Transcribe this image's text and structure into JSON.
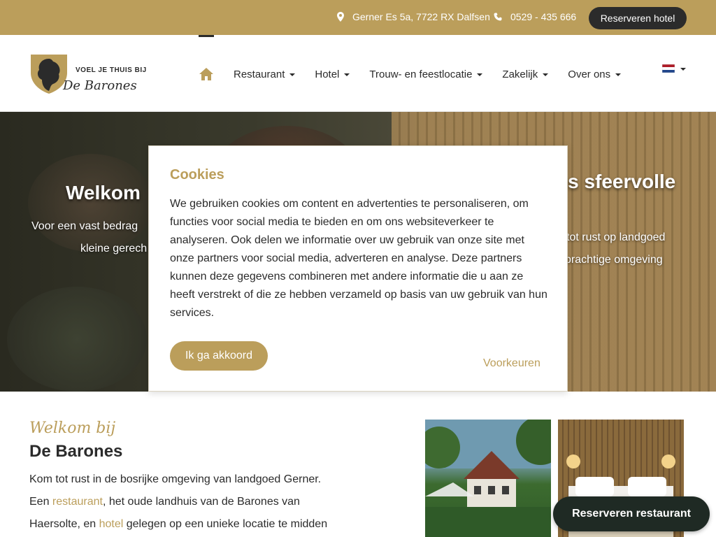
{
  "topbar": {
    "address": "Gerner Es 5a, 7722 RX Dalfsen",
    "phone": "0529 - 435 666",
    "reserve_hotel_label": "Reserveren hotel",
    "address_icon": "map-marker-icon",
    "phone_icon": "phone-icon"
  },
  "logo": {
    "tagline": "VOEL JE THUIS BIJ",
    "brand": "De Barones"
  },
  "nav": {
    "home_icon": "home-icon",
    "items": [
      {
        "label": "Restaurant"
      },
      {
        "label": "Hotel"
      },
      {
        "label": "Trouw- en feestlocatie"
      },
      {
        "label": "Zakelijk"
      },
      {
        "label": "Over ons"
      }
    ],
    "language_flag": "dutch-flag-icon"
  },
  "hero": {
    "title_left": "Welkom",
    "text_left_line1": "Voor een vast bedrag",
    "text_left_line2": "kleine gerech",
    "title_right": "ns sfeervolle",
    "text_right_line1": "tot rust op landgoed",
    "text_right_line2": "prachtige omgeving"
  },
  "cookie": {
    "title": "Cookies",
    "body": "We gebruiken cookies om content en advertenties te personaliseren, om functies voor social media te bieden en om ons websiteverkeer te analyseren. Ook delen we informatie over uw gebruik van onze site met onze partners voor social media, adverteren en analyse. Deze partners kunnen deze gegevens combineren met andere informatie die u aan ze heeft verstrekt of die ze hebben verzameld op basis van uw gebruik van hun services.",
    "accept_label": "Ik ga akkoord",
    "prefs_label": "Voorkeuren"
  },
  "welcome": {
    "script": "Welkom bij",
    "title": "De Barones",
    "line1": "Kom tot rust in de bosrijke omgeving van landgoed Gerner.",
    "line2_pre": "Een ",
    "line2_link": "restaurant",
    "line2_post": ", het oude landhuis van de Barones van",
    "line3_pre": "Haersolte, en ",
    "line3_link": "hotel",
    "line3_post": " gelegen op een unieke locatie te midden"
  },
  "floating": {
    "reserve_restaurant_label": "Reserveren restaurant"
  },
  "colors": {
    "accent": "#bb9e5b",
    "dark": "#2b2b2b",
    "reserve_restaurant_bg": "#1f2a24"
  }
}
